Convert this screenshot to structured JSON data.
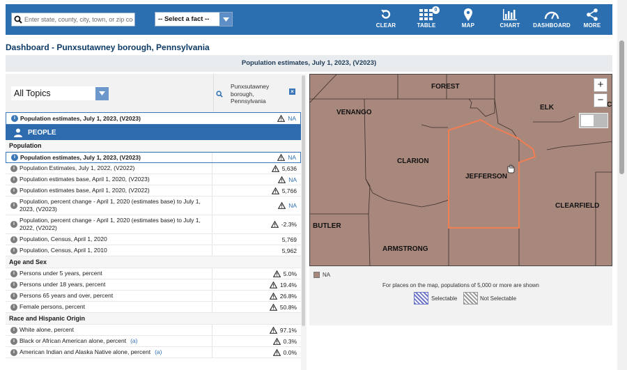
{
  "nav": {
    "search_placeholder": "Enter state, county, city, town, or zip code",
    "fact_select": "-- Select a fact --",
    "table_badge": "0",
    "buttons": {
      "clear": "CLEAR",
      "table": "TABLE",
      "map": "MAP",
      "chart": "CHART",
      "dashboard": "DASHBOARD",
      "more": "MORE"
    }
  },
  "page_title": "Dashboard - Punxsutawney borough, Pennsylvania",
  "subheader": "Population estimates, July 1, 2023, (V2023)",
  "topics_select": "All Topics",
  "column": {
    "name": "Punxsutawney borough, Pennsylvania",
    "close": "×"
  },
  "selected_fact": {
    "label": "Population estimates, July 1, 2023, (V2023)",
    "value": "NA"
  },
  "people_header": "PEOPLE",
  "sections": {
    "population": "Population",
    "age_sex": "Age and Sex",
    "race": "Race and Hispanic Origin"
  },
  "rows": [
    {
      "label": "Population estimates, July 1, 2023, (V2023)",
      "value": "NA"
    },
    {
      "label": "Population Estimates, July 1, 2022, (V2022)",
      "value": "5,636"
    },
    {
      "label": "Population estimates base, April 1, 2020, (V2023)",
      "value": "NA"
    },
    {
      "label": "Population estimates base, April 1, 2020, (V2022)",
      "value": "5,766"
    },
    {
      "label": "Population, percent change - April 1, 2020 (estimates base) to July 1, 2023, (V2023)",
      "value": "NA"
    },
    {
      "label": "Population, percent change - April 1, 2020 (estimates base) to July 1, 2022, (V2022)",
      "value": "-2.3%"
    },
    {
      "label": "Population, Census, April 1, 2020",
      "value": "5,769"
    },
    {
      "label": "Population, Census, April 1, 2010",
      "value": "5,962"
    },
    {
      "label": "Persons under 5 years, percent",
      "value": "5.0%"
    },
    {
      "label": "Persons under 18 years, percent",
      "value": "19.4%"
    },
    {
      "label": "Persons 65 years and over, percent",
      "value": "26.8%"
    },
    {
      "label": "Female persons, percent",
      "value": "50.8%"
    },
    {
      "label": "White alone, percent",
      "value": "97.1%"
    },
    {
      "label": "Black or African American alone, percent",
      "footnote": "(a)",
      "value": "0.3%"
    },
    {
      "label": "American Indian and Alaska Native alone, percent",
      "footnote": "(a)",
      "value": "0.0%"
    }
  ],
  "map": {
    "counties": [
      "FOREST",
      "ELK",
      "VENANGO",
      "CLARION",
      "JEFFERSON",
      "CLEARFIELD",
      "BUTLER",
      "ARMSTRONG",
      "C"
    ],
    "zoom_in": "+",
    "zoom_out": "−",
    "legend_na": "NA",
    "note": "For places on the map, populations of 5,000 or more are shown",
    "selectable": "Selectable",
    "not_selectable": "Not Selectable",
    "fill_color": "#a8877c",
    "highlight_color": "#f07e52"
  },
  "icons": {
    "search": "search-icon",
    "dropdown": "chevron-down-icon",
    "clear": "undo-icon",
    "table": "grid-icon",
    "map": "map-pin-icon",
    "chart": "bar-chart-icon",
    "dashboard": "gauge-icon",
    "more": "share-icon",
    "info": "info-icon",
    "warning": "warning-icon",
    "person": "person-icon",
    "close": "close-icon"
  }
}
